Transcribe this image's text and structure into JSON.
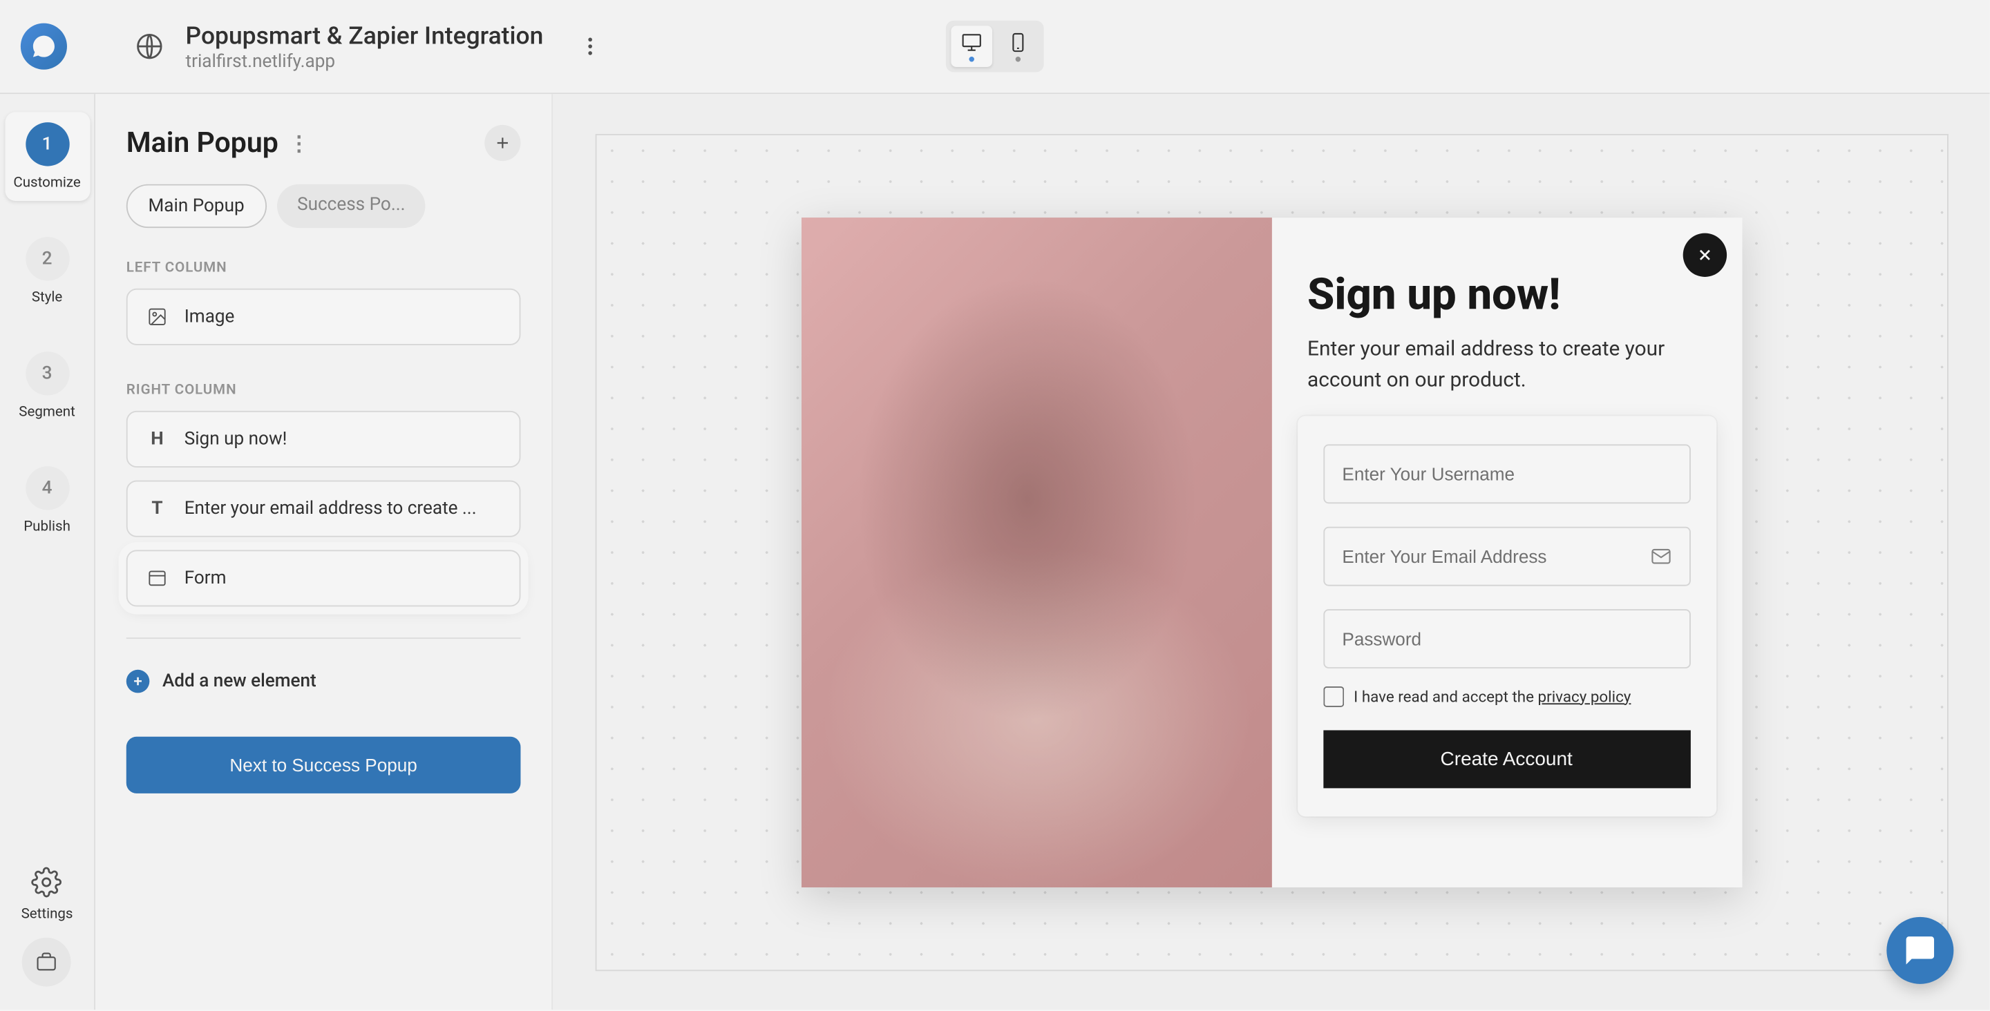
{
  "header": {
    "title": "Popupsmart & Zapier Integration",
    "subtitle": "trialfirst.netlify.app"
  },
  "steps": [
    {
      "num": "1",
      "label": "Customize"
    },
    {
      "num": "2",
      "label": "Style"
    },
    {
      "num": "3",
      "label": "Segment"
    },
    {
      "num": "4",
      "label": "Publish"
    }
  ],
  "rail": {
    "settings": "Settings"
  },
  "sidebar": {
    "title": "Main Popup",
    "tabs": [
      {
        "label": "Main Popup"
      },
      {
        "label": "Success Po..."
      }
    ],
    "left_column_label": "LEFT COLUMN",
    "left_items": [
      {
        "label": "Image"
      }
    ],
    "right_column_label": "RIGHT COLUMN",
    "right_items": [
      {
        "label": "Sign up now!"
      },
      {
        "label": "Enter your email address to create ..."
      },
      {
        "label": "Form"
      }
    ],
    "add_element": "Add a new element",
    "next_button": "Next to Success Popup"
  },
  "popup": {
    "heading": "Sign up now!",
    "subtext": "Enter your email address to create your account on our product.",
    "username_placeholder": "Enter Your Username",
    "email_placeholder": "Enter Your Email Address",
    "password_placeholder": "Password",
    "consent_prefix": "I have read and accept the ",
    "consent_link": "privacy policy",
    "submit": "Create Account"
  }
}
